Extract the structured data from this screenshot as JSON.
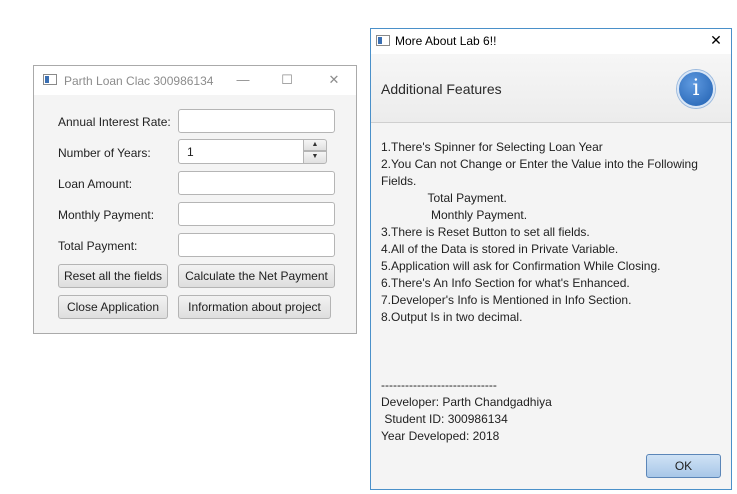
{
  "loan_window": {
    "title": "Parth Loan Clac 300986134",
    "controls": {
      "minimize": "—",
      "maximize": "☐",
      "close": "✕"
    },
    "fields": [
      {
        "label": "Annual Interest Rate:",
        "value": ""
      },
      {
        "label": "Number of Years:",
        "value": "1"
      },
      {
        "label": "Loan Amount:",
        "value": ""
      },
      {
        "label": "Monthly Payment:",
        "value": ""
      },
      {
        "label": "Total Payment:",
        "value": ""
      }
    ],
    "buttons": {
      "reset": "Reset all the fields",
      "calculate": "Calculate the Net Payment",
      "close": "Close Application",
      "information": "Information about project"
    }
  },
  "info_dialog": {
    "title": "More About Lab 6!!",
    "close": "✕",
    "header": "Additional Features",
    "icon_glyph": "i",
    "lines": [
      "1.There's Spinner for Selecting Loan Year",
      "2.You Can not Change or Enter the Value into the Following",
      "Fields.",
      "              Total Payment.",
      "               Monthly Payment.",
      "3.There is Reset Button to set all fields.",
      "4.All of the Data is stored in Private Variable.",
      "5.Application will ask for Confirmation While Closing.",
      "6.There's An Info Section for what's Enhanced.",
      "7.Developer's Info is Mentioned in Info Section.",
      "8.Output Is in two decimal."
    ],
    "separator": "-----------------------------",
    "developer": "Developer: Parth Chandgadhiya",
    "student_id": " Student ID: 300986134",
    "year": "Year Developed: 2018",
    "ok": "OK"
  },
  "colors": {
    "dialog_border": "#4a90c9",
    "info_icon": "#1f5fb0",
    "ok_button": "#a8c7e8"
  }
}
